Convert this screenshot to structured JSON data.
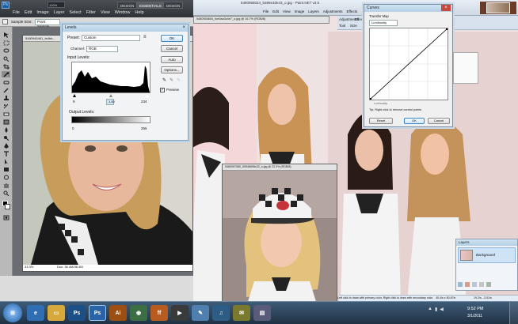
{
  "photoshop": {
    "menus": [
      "File",
      "Edit",
      "Image",
      "Layer",
      "Select",
      "Filter",
      "View",
      "Window",
      "Help"
    ],
    "workspaces": [
      "DESIGN",
      "ESSENTIALS",
      "DESIGN"
    ],
    "cs_live": "CS Live",
    "options_label": "Sample Size:",
    "options_value": "Point Sample",
    "doc1_title": "5480945461_fe4bb...",
    "doc1_zoom": "33.3%",
    "doc1_status": "Doc: 36.4M/36.4M"
  },
  "levels": {
    "title": "Levels",
    "preset_label": "Preset:",
    "preset_value": "Custom",
    "channel_label": "Channel:",
    "channel_value": "RGB",
    "input_label": "Input Levels:",
    "input_values": [
      "9",
      "1.00",
      "234"
    ],
    "output_label": "Output Levels:",
    "output_values": [
      "0",
      "255"
    ],
    "buttons": [
      "OK",
      "Cancel",
      "Auto",
      "Options..."
    ],
    "preview_label": "Preview",
    "preview_checked": true
  },
  "windows": {
    "doc2_title": "5480934604_fce0aa3c4e7_o.jpg @ 16.7% (RGB/8)",
    "doc3_title": "5480957080_59546698c32_o.jpg @ 22.3% (RGB/8)"
  },
  "paintnet": {
    "menus": [
      "File",
      "Edit",
      "View",
      "Image",
      "Layers",
      "Adjustments",
      "Effects"
    ],
    "title": "5480958024_ba96e3de43_o.jpg - Paint.NET v3.5",
    "tab_labels": [
      "Adjustments",
      "Effects",
      "Tool",
      "Size"
    ],
    "status_hint": "Left click to draw with primary color, Right click to draw with secondary color",
    "status_size": "40.4in x 60.67in",
    "status_pos": "19.2in, -3.51in"
  },
  "curves": {
    "title": "Curves",
    "mode_label": "Transfer Map",
    "mode_value": "Luminosity",
    "axis_label": "Luminosity",
    "tip": "Tip: Right click to remove control points",
    "buttons": [
      "Reset",
      "OK",
      "Cancel"
    ]
  },
  "layers_panel": {
    "title": "Layers",
    "layer_name": "Background"
  },
  "taskbar": {
    "time": "9:52 PM",
    "date": "3/1/2011",
    "apps": [
      "start",
      "ie",
      "explorer",
      "ps",
      "ps-active",
      "ai",
      "chrome",
      "firefox",
      "winamp",
      "paint-net",
      "media",
      "notes",
      "misc"
    ]
  },
  "colors": {
    "ps_dark": "#2f3236",
    "pdn_blue": "#cfd9e4",
    "taskbar": "#203244",
    "accent": "#3d86c6"
  }
}
